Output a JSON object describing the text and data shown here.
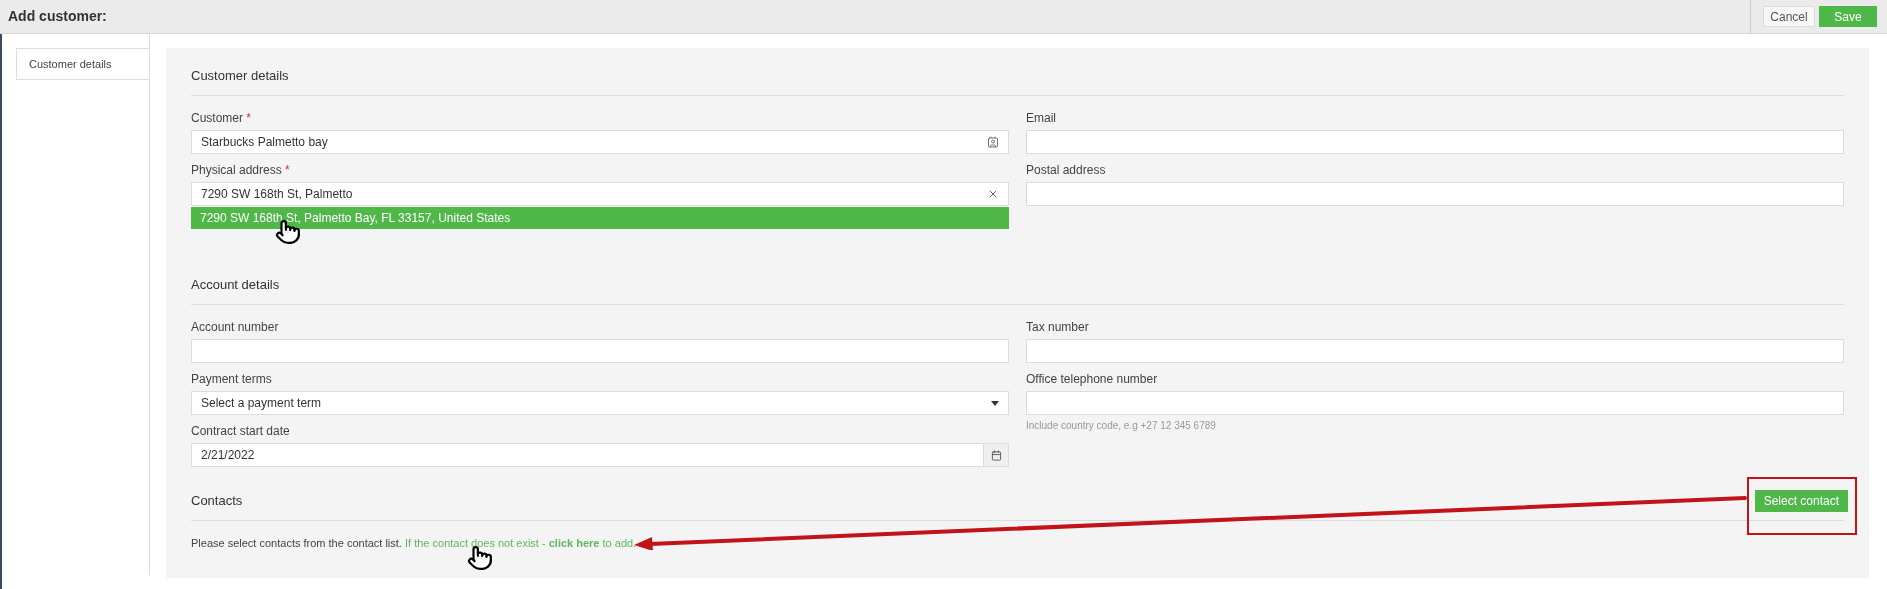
{
  "header": {
    "title": "Add customer:",
    "buttons": [
      {
        "label": "Cancel",
        "kind": "secondary"
      },
      {
        "label": "Save",
        "kind": "primary"
      }
    ]
  },
  "sidebar": {
    "tabs": [
      {
        "label": "Customer details",
        "selected": true
      }
    ]
  },
  "sections": [
    {
      "title": "Customer details",
      "left_fields": [
        {
          "label": "Customer",
          "required_mark": "*",
          "kind": "lookup",
          "value": "Starbucks Palmetto bay"
        },
        {
          "label": "Physical address",
          "required_mark": "*",
          "kind": "clearable",
          "value": "7290 SW 168th St, Palmetto",
          "suggestions": [
            {
              "text": "7290 SW 168th St, Palmetto Bay, FL 33157, United States",
              "selected": true
            }
          ]
        }
      ],
      "right_fields": [
        {
          "label": "Email",
          "kind": "text"
        },
        {
          "label": "Postal address",
          "kind": "text"
        }
      ]
    },
    {
      "title": "Account details",
      "left_fields": [
        {
          "label": "Account number",
          "kind": "text"
        },
        {
          "label": "Payment terms",
          "kind": "select",
          "value": "Select a payment term"
        },
        {
          "label": "Contract start date",
          "kind": "date",
          "value": "2/21/2022"
        }
      ],
      "right_fields": [
        {
          "label": "Tax number",
          "kind": "text"
        },
        {
          "label": "Office telephone number",
          "kind": "text",
          "hint": "Include country code, e.g +27 12 345 6789"
        }
      ]
    }
  ],
  "contacts": {
    "title": "Contacts",
    "button": "Select contact",
    "message": "Please select contacts from the contact list.",
    "note_before": "If the contact does not exist -",
    "link": "click here",
    "note_after": "to add."
  }
}
